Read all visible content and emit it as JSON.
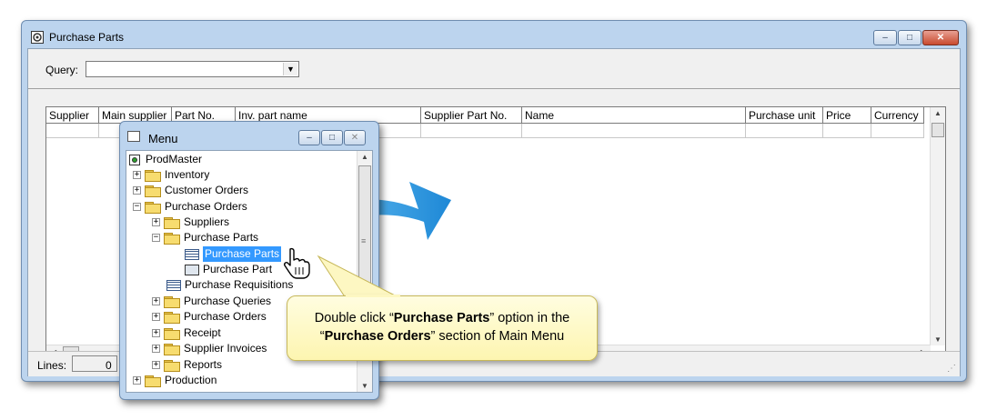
{
  "main_window": {
    "title": "Purchase Parts",
    "caption_buttons": {
      "minimize": "‒",
      "maximize": "□",
      "close": "✕"
    }
  },
  "query": {
    "label": "Query:",
    "value": "",
    "arrow": "▼"
  },
  "grid": {
    "columns": [
      "Supplier",
      "Main supplier",
      "Part No.",
      "Inv. part name",
      "Supplier Part No.",
      "Name",
      "Purchase unit",
      "Price",
      "Currency"
    ]
  },
  "status": {
    "lines_label": "Lines:",
    "lines_value": "0"
  },
  "menu_window": {
    "title": "Menu",
    "tree": [
      {
        "label": "ProdMaster",
        "icon": "root-icon"
      },
      {
        "label": "Inventory",
        "icon": "folder-icon",
        "toggle": "+"
      },
      {
        "label": "Customer Orders",
        "icon": "folder-icon",
        "toggle": "+"
      },
      {
        "label": "Purchase Orders",
        "icon": "folder-open-icon",
        "toggle": "−"
      },
      {
        "label": "Suppliers",
        "icon": "folder-icon",
        "toggle": "+"
      },
      {
        "label": "Purchase Parts",
        "icon": "folder-open-icon",
        "toggle": "−"
      },
      {
        "label": "Purchase Parts",
        "icon": "grid-icon",
        "selected": true
      },
      {
        "label": "Purchase Part",
        "icon": "form-icon"
      },
      {
        "label": "Purchase Requisitions",
        "icon": "grid-icon"
      },
      {
        "label": "Purchase Queries",
        "icon": "folder-icon",
        "toggle": "+"
      },
      {
        "label": "Purchase Orders",
        "icon": "folder-icon",
        "toggle": "+"
      },
      {
        "label": "Receipt",
        "icon": "folder-icon",
        "toggle": "+"
      },
      {
        "label": "Supplier Invoices",
        "icon": "folder-icon",
        "toggle": "+"
      },
      {
        "label": "Reports",
        "icon": "folder-icon",
        "toggle": "+"
      },
      {
        "label": "Production",
        "icon": "folder-icon",
        "toggle": "+"
      }
    ]
  },
  "callout": {
    "part1": "Double click “",
    "bold1": "Purchase Parts",
    "part2": "” option in the",
    "part3": "“",
    "bold2": "Purchase Orders",
    "part4": "” section of Main Menu"
  },
  "colors": {
    "accent_arrow": "#3aa3e3",
    "selection": "#3399ff",
    "callout_bg": "#fdf5b0"
  }
}
